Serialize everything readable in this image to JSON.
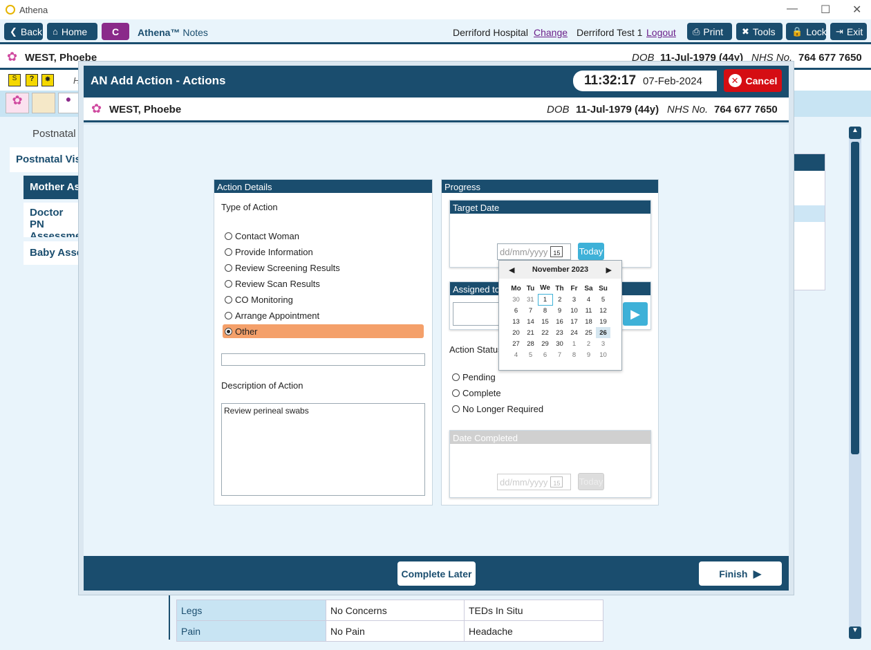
{
  "app": {
    "title": "Athena"
  },
  "toolbar": {
    "back": "Back",
    "home": "Home",
    "c_label": "C",
    "athena_brand": "Athena™",
    "notes": "Notes",
    "hospital": "Derriford Hospital",
    "change": "Change",
    "user": "Derriford Test 1",
    "logout": "Logout",
    "print": "Print",
    "tools": "Tools",
    "lock": "Lock",
    "exit": "Exit"
  },
  "patient": {
    "name": "WEST, Phoebe",
    "dob_label": "DOB",
    "dob": "11-Jul-1979 (44y)",
    "nhs_label": "NHS No.",
    "nhs": "764 677 7650"
  },
  "background": {
    "h_label": "H",
    "section": "Postnatal (",
    "nav": [
      "Postnatal Visit",
      "Mother Ass",
      "Doctor PN Assessmen",
      "Baby Asses"
    ],
    "table_rows": [
      {
        "label": "Legs",
        "value": "No Concerns",
        "extra": "TEDs In Situ"
      },
      {
        "label": "Pain",
        "value": "No Pain",
        "extra": "Headache"
      }
    ]
  },
  "modal": {
    "title": "AN Add Action - Actions",
    "time": "11:32:17",
    "date": "07-Feb-2024",
    "cancel": "Cancel",
    "complete_later": "Complete Later",
    "finish": "Finish"
  },
  "action_details": {
    "header": "Action Details",
    "type_label": "Type of Action",
    "options": [
      "Contact Woman",
      "Provide Information",
      "Review Screening Results",
      "Review Scan Results",
      "CO Monitoring",
      "Arrange Appointment",
      "Other"
    ],
    "selected": "Other",
    "other_value": "",
    "description_label": "Description of Action",
    "description": "Review perineal swabs"
  },
  "progress": {
    "header": "Progress",
    "target_date": {
      "header": "Target Date",
      "placeholder": "dd/mm/yyyy",
      "today": "Today"
    },
    "assigned_to": {
      "header": "Assigned to"
    },
    "status_label": "Action Status",
    "status_options": [
      "Pending",
      "Complete",
      "No Longer Required"
    ],
    "date_completed": {
      "header": "Date Completed",
      "placeholder": "dd/mm/yyyy",
      "today": "Today"
    }
  },
  "calendar": {
    "month": "November 2023",
    "weekdays": [
      "Mo",
      "Tu",
      "We",
      "Th",
      "Fr",
      "Sa",
      "Su"
    ],
    "weeks": [
      [
        "30",
        "31",
        "1",
        "2",
        "3",
        "4",
        "5"
      ],
      [
        "6",
        "7",
        "8",
        "9",
        "10",
        "11",
        "12"
      ],
      [
        "13",
        "14",
        "15",
        "16",
        "17",
        "18",
        "19"
      ],
      [
        "20",
        "21",
        "22",
        "23",
        "24",
        "25",
        "26"
      ],
      [
        "27",
        "28",
        "29",
        "30",
        "1",
        "2",
        "3"
      ],
      [
        "4",
        "5",
        "6",
        "7",
        "8",
        "9",
        "10"
      ]
    ],
    "today_day": "1",
    "selected_day": "26",
    "calendar_icon_text": "15"
  },
  "colors": {
    "primary": "#1a4d6e",
    "accent": "#3eb1d8",
    "selected_option": "#f4a06a",
    "cancel": "#d50d13"
  }
}
